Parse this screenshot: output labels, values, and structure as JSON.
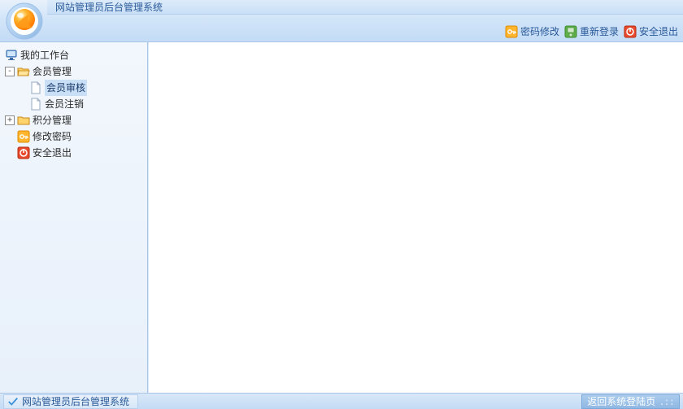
{
  "header": {
    "title": "网站管理员后台管理系统",
    "links": {
      "change_password": "密码修改",
      "relogin": "重新登录",
      "safe_exit": "安全退出"
    }
  },
  "sidebar": {
    "workbench": "我的工作台",
    "member_mgmt": "会员管理",
    "member_audit": "会员审核",
    "member_cancel": "会员注销",
    "points_mgmt": "积分管理",
    "change_password": "修改密码",
    "safe_exit": "安全退出"
  },
  "footer": {
    "left": "网站管理员后台管理系统",
    "right": "返回系统登陆页"
  },
  "colors": {
    "accent": "#2a5a9a",
    "header_grad_top": "#e8f1fb",
    "header_grad_bot": "#c3dbf5"
  }
}
